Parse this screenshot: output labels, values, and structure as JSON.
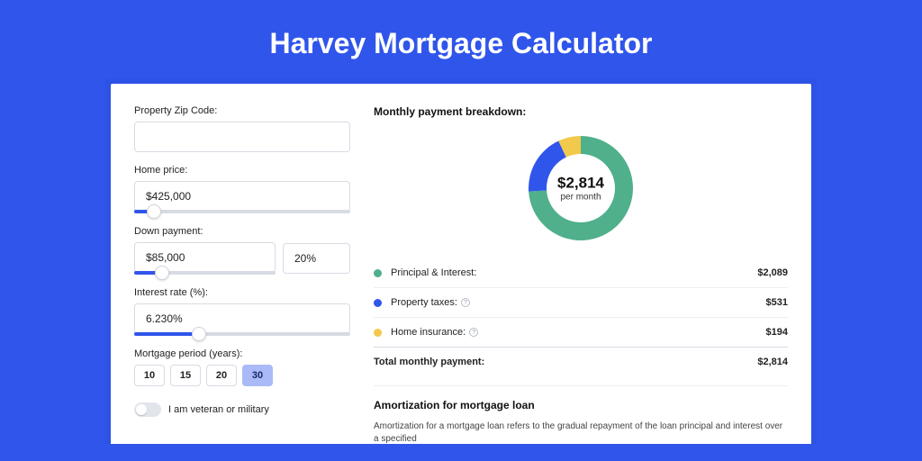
{
  "hero": {
    "title": "Harvey Mortgage Calculator"
  },
  "form": {
    "zip_label": "Property Zip Code:",
    "zip_value": "",
    "home_price_label": "Home price:",
    "home_price_value": "$425,000",
    "home_price_slider_pct": 9,
    "down_payment_label": "Down payment:",
    "down_payment_value": "$85,000",
    "down_payment_pct_value": "20%",
    "down_payment_slider_pct": 20,
    "interest_label": "Interest rate (%):",
    "interest_value": "6.230%",
    "interest_slider_pct": 30,
    "period_label": "Mortgage period (years):",
    "period_options": [
      "10",
      "15",
      "20",
      "30"
    ],
    "period_selected": "30",
    "veteran_label": "I am veteran or military",
    "veteran_on": false
  },
  "breakdown": {
    "title": "Monthly payment breakdown:",
    "center_amount": "$2,814",
    "center_sub": "per month",
    "items": [
      {
        "label": "Principal & Interest:",
        "amount": "$2,089",
        "color": "#4fb08b",
        "info": false,
        "pct": 74
      },
      {
        "label": "Property taxes:",
        "amount": "$531",
        "color": "#3055eb",
        "info": true,
        "pct": 19
      },
      {
        "label": "Home insurance:",
        "amount": "$194",
        "color": "#f3c94b",
        "info": true,
        "pct": 7
      }
    ],
    "total_label": "Total monthly payment:",
    "total_amount": "$2,814"
  },
  "amort": {
    "title": "Amortization for mortgage loan",
    "text": "Amortization for a mortgage loan refers to the gradual repayment of the loan principal and interest over a specified"
  },
  "chart_data": {
    "type": "pie",
    "title": "Monthly payment breakdown",
    "categories": [
      "Principal & Interest",
      "Property taxes",
      "Home insurance"
    ],
    "values": [
      2089,
      531,
      194
    ],
    "colors": [
      "#4fb08b",
      "#3055eb",
      "#f3c94b"
    ],
    "total": 2814,
    "center_label": "$2,814 per month"
  }
}
